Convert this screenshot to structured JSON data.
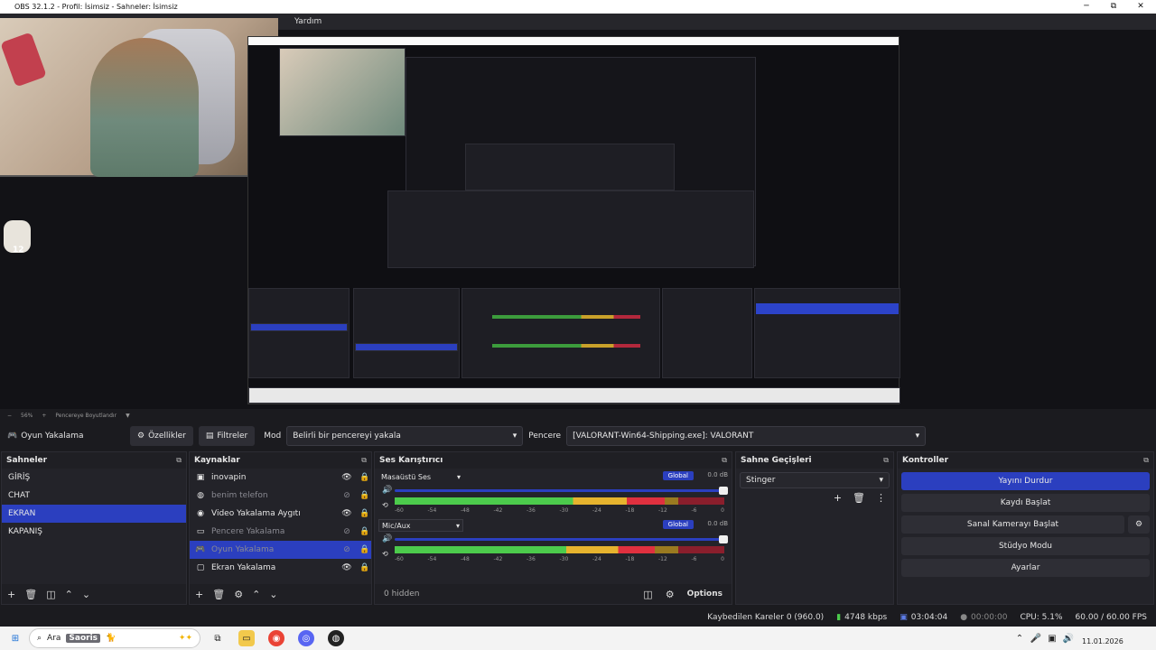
{
  "window": {
    "title": "OBS 32.1.2 - Profil: İsimsiz - Sahneler: İsimsiz",
    "minimize": "─",
    "maximize": "⧉",
    "close": "✕"
  },
  "menu": {
    "help": "Yardım"
  },
  "preview": {
    "overlay_badge": "12",
    "zoom_level": "56%",
    "zoom_mode": "Pencereye Boyutlandır"
  },
  "toolbar": {
    "source_name": "Oyun Yakalama",
    "properties_label": "Özellikler",
    "filters_label": "Filtreler",
    "mode_label": "Mod",
    "mode_value": "Belirli bir pencereyi yakala",
    "window_label": "Pencere",
    "window_value": "[VALORANT-Win64-Shipping.exe]: VALORANT"
  },
  "scenes": {
    "title": "Sahneler",
    "items": [
      "GİRİŞ",
      "CHAT",
      "EKRAN",
      "KAPANIŞ"
    ],
    "selected_index": 2
  },
  "sources": {
    "title": "Kaynaklar",
    "items": [
      {
        "label": "inovapin",
        "icon": "image-icon",
        "visible": true
      },
      {
        "label": "benim telefon",
        "icon": "browser-icon",
        "visible": false
      },
      {
        "label": "Video Yakalama Aygıtı",
        "icon": "camera-icon",
        "visible": true
      },
      {
        "label": "Pencere Yakalama",
        "icon": "window-icon",
        "visible": false
      },
      {
        "label": "Oyun Yakalama",
        "icon": "gamepad-icon",
        "visible": false
      },
      {
        "label": "Ekran Yakalama",
        "icon": "monitor-icon",
        "visible": true
      }
    ],
    "selected_index": 4
  },
  "mixer": {
    "title": "Ses Karıştırıcı",
    "channels": [
      {
        "name": "Masaüstü Ses",
        "global": "Global",
        "db": "0.0 dB",
        "volume": 1.0,
        "level": 0.82
      },
      {
        "name": "Mic/Aux",
        "global": "Global",
        "db": "0.0 dB",
        "volume": 1.0,
        "level": 0.79
      }
    ],
    "ticks": [
      "-60",
      "-54",
      "-48",
      "-42",
      "-36",
      "-30",
      "-24",
      "-18",
      "-12",
      "-6",
      "0"
    ],
    "hidden_label": "0 hidden",
    "options_label": "Options"
  },
  "transitions": {
    "title": "Sahne Geçişleri",
    "selected": "Stinger"
  },
  "controls": {
    "title": "Kontroller",
    "stop_stream": "Yayını Durdur",
    "start_record": "Kaydı Başlat",
    "virtual_cam": "Sanal Kamerayı Başlat",
    "studio_mode": "Stüdyo Modu",
    "settings": "Ayarlar"
  },
  "status": {
    "dropped_frames": "Kaybedilen Kareler 0 (960.0)",
    "bitrate": "4748 kbps",
    "stream_time": "03:04:04",
    "record_time": "00:00:00",
    "cpu": "CPU: 5.1%",
    "fps": "60.00 / 60.00 FPS"
  },
  "taskbar": {
    "search_label": "Ara",
    "search_badge": "Saoris",
    "date": "11.01.2026"
  },
  "colors": {
    "accent": "#2b3fbf",
    "panel": "#232329",
    "background": "#1b1b1f"
  }
}
